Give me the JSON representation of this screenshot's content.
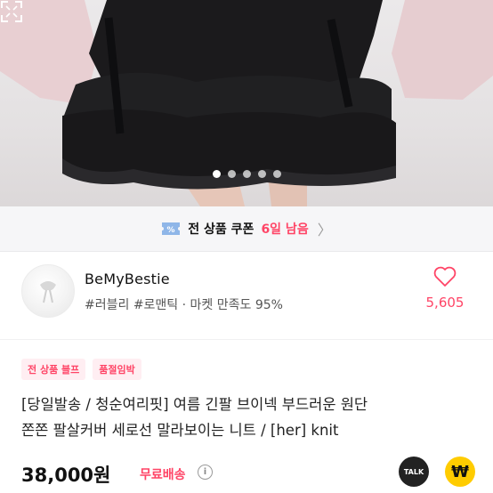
{
  "coupon": {
    "text": "전 상품 쿠폰",
    "accent": "6일 남음",
    "chevron": "〉"
  },
  "seller": {
    "name": "BeMyBestie",
    "meta": "#러블리 #로맨틱 · 마켓 만족도 95%",
    "likes": "5,605"
  },
  "badges": [
    "전 상품 블프",
    "품절임박"
  ],
  "product": {
    "title_line1": "[당일발송 / 청순여리핏] 여름 긴팔 브이넥 부드러운 원단",
    "title_line2": "쫀쫀 팔살커버 세로선 말라보이는 니트 / [her] knit",
    "price": "38,000원",
    "shipping": "무료배송",
    "info": "i"
  },
  "actions": {
    "talk": "TALK",
    "pay": "₩"
  },
  "colors": {
    "accent": "#ff4466",
    "background": "#ffffff"
  },
  "icons": [
    "coupon-ticket-icon",
    "chevron-right-icon",
    "heart-icon",
    "expand-icon",
    "info-icon",
    "talk-icon",
    "pay-icon"
  ]
}
